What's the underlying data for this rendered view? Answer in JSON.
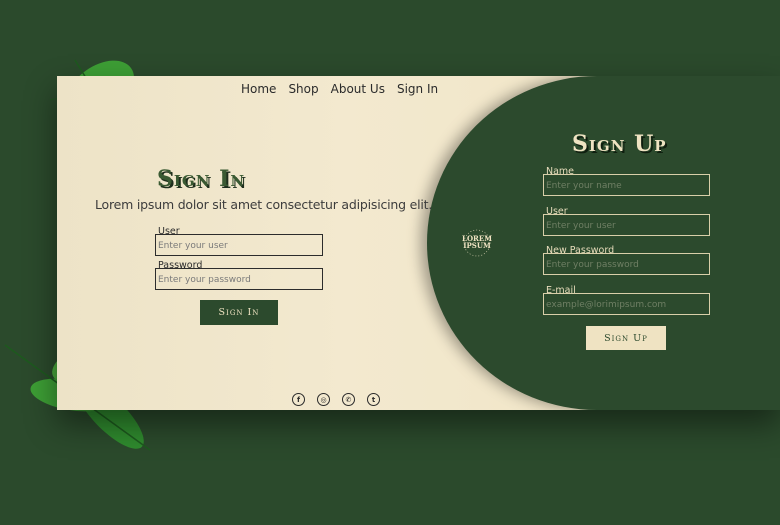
{
  "nav": {
    "items": [
      "Home",
      "Shop",
      "About Us",
      "Sign In"
    ]
  },
  "signin": {
    "title": "Sign In",
    "subtitle": "Lorem ipsum dolor sit amet consectetur adipisicing elit.",
    "user_label": "User",
    "user_placeholder": "Enter your user",
    "password_label": "Password",
    "password_placeholder": "Enter your password",
    "button": "Sign In"
  },
  "social": {
    "icons": [
      "facebook-icon",
      "instagram-icon",
      "whatsapp-icon",
      "twitter-icon"
    ]
  },
  "logo": {
    "text_line1": "LOREM",
    "text_line2": "IPSUM"
  },
  "signup": {
    "title": "Sign Up",
    "name_label": "Name",
    "name_placeholder": "Enter your name",
    "user_label": "User",
    "user_placeholder": "Enter your user",
    "password_label": "New Password",
    "password_placeholder": "Enter your password",
    "email_label": "E-mail",
    "email_placeholder": "example@lorimipsum.com",
    "button": "Sign Up"
  },
  "colors": {
    "dark_green": "#2c4a2d",
    "cream": "#efe3c2",
    "background": "#2b4a2c"
  }
}
